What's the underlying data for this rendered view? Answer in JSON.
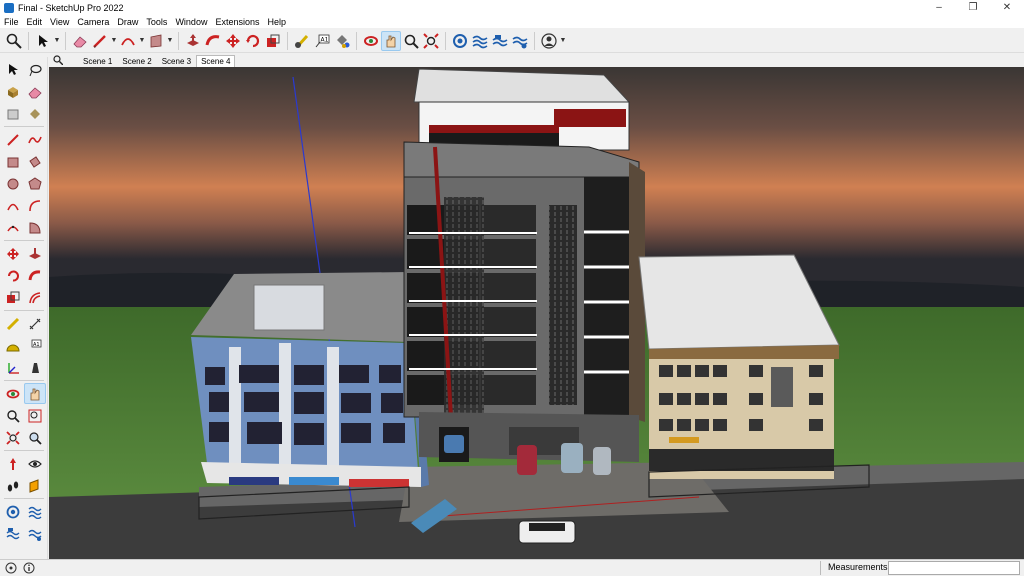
{
  "window": {
    "title": "Final - SketchUp Pro 2022",
    "minimize": "–",
    "maximize": "❐",
    "close": "✕"
  },
  "menu": [
    "File",
    "Edit",
    "View",
    "Camera",
    "Draw",
    "Tools",
    "Window",
    "Extensions",
    "Help"
  ],
  "toolbar": {
    "tools": [
      "search-icon",
      "select-icon",
      "eraser-icon",
      "pencil-line-icon",
      "arc-icon",
      "rectangle-shape-icon",
      "pushpull-icon",
      "followme-icon",
      "move-icon",
      "rotate-icon",
      "scale-icon",
      "tape-measure-icon",
      "text-icon",
      "paint-bucket-icon",
      "orbit-icon",
      "pan-icon",
      "zoom-icon",
      "zoom-extents-icon",
      "warehouse-icon",
      "extension-warehouse-icon",
      "layout-icon",
      "extension-manager-icon",
      "account-icon"
    ]
  },
  "scenes": {
    "tabs": [
      "Scene 1",
      "Scene 2",
      "Scene 3",
      "Scene 4"
    ],
    "active": "Scene 4"
  },
  "status": {
    "measurements_label": "Measurements",
    "measurements_value": ""
  },
  "colors": {
    "sky_top": "#3a3634",
    "sky_glow": "#e08850",
    "grass": "#4e7a34",
    "road": "#3c3c3c",
    "accent_red": "#8b1414"
  }
}
